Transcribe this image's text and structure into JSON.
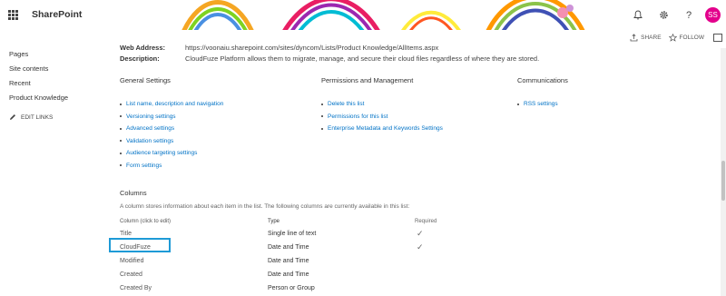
{
  "suite": {
    "brand": "SharePoint",
    "help_glyph": "?",
    "avatar_initials": "SS"
  },
  "actions": {
    "share": "SHARE",
    "follow": "FOLLOW"
  },
  "nav": {
    "items": [
      "Pages",
      "Site contents",
      "Recent",
      "Product Knowledge"
    ],
    "edit_links": "EDIT LINKS"
  },
  "info": {
    "web_address_label": "Web Address:",
    "web_address_value": "https://voonaiu.sharepoint.com/sites/dyncom/Lists/Product Knowledge/AllItems.aspx",
    "description_label": "Description:",
    "description_value": "CloudFuze Platform allows them to migrate, manage, and secure their cloud files regardless of where they are stored."
  },
  "settings": {
    "general": {
      "heading": "General Settings",
      "links": [
        "List name, description and navigation",
        "Versioning settings",
        "Advanced settings",
        "Validation settings",
        "Audience targeting settings",
        "Form settings"
      ]
    },
    "permissions": {
      "heading": "Permissions and Management",
      "links": [
        "Delete this list",
        "Permissions for this list",
        "Enterprise Metadata and Keywords Settings"
      ]
    },
    "communications": {
      "heading": "Communications",
      "links": [
        "RSS settings"
      ]
    }
  },
  "columns": {
    "title": "Columns",
    "description": "A column stores information about each item in the list. The following columns are currently available in this list:",
    "headers": {
      "column": "Column (click to edit)",
      "type": "Type",
      "required": "Required"
    },
    "rows": [
      {
        "name": "Title",
        "type": "Single line of text",
        "required": true
      },
      {
        "name": "CloudFuze",
        "type": "Date and Time",
        "required": true
      },
      {
        "name": "Modified",
        "type": "Date and Time",
        "required": false
      },
      {
        "name": "Created",
        "type": "Date and Time",
        "required": false
      },
      {
        "name": "Created By",
        "type": "Person or Group",
        "required": false
      }
    ]
  },
  "colors": {
    "link": "#0072c6",
    "avatar_bg": "#e3008c",
    "highlight_border": "#1e9ad6"
  }
}
